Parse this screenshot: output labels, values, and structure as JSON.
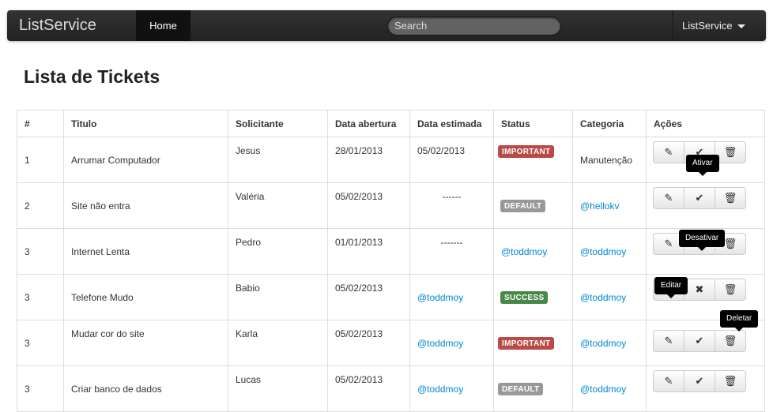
{
  "navbar": {
    "brand": "ListService",
    "home": "Home",
    "search_placeholder": "Search",
    "dropdown": "ListService"
  },
  "page": {
    "title": "Lista de Tickets"
  },
  "table": {
    "headers": [
      "#",
      "Titulo",
      "Solicitante",
      "Data abertura",
      "Data estimada",
      "Status",
      "Categoria",
      "Ações"
    ],
    "rows": [
      {
        "num": "1",
        "titulo": "Arrumar Computador",
        "solicitante": "Jesus",
        "abertura": "28/01/2013",
        "estimada": "05/02/2013",
        "status": "IMPORTANT",
        "categoria": "Manutenção"
      },
      {
        "num": "2",
        "titulo": "Site não entra",
        "solicitante": "Valéria",
        "abertura": "05/02/2013",
        "estimada": "------",
        "status": "DEFAULT",
        "categoria": "@hellokv"
      },
      {
        "num": "3",
        "titulo": "Internet Lenta",
        "solicitante": "Pedro",
        "abertura": "01/01/2013",
        "estimada": "-------",
        "status": "@toddmoy",
        "categoria": "@toddmoy"
      },
      {
        "num": "3",
        "titulo": "Telefone Mudo",
        "solicitante": "Babio",
        "abertura": "05/02/2013",
        "estimada": "@toddmoy",
        "status": "SUCCESS",
        "categoria": "@toddmoy"
      },
      {
        "num": "3",
        "titulo": "Mudar cor do site",
        "solicitante": "Karla",
        "abertura": "05/02/2013",
        "estimada": "@toddmoy",
        "status": "IMPORTANT",
        "categoria": "@toddmoy"
      },
      {
        "num": "3",
        "titulo": "Criar banco de dados",
        "solicitante": "Lucas",
        "abertura": "05/02/2013",
        "estimada": "@toddmoy",
        "status": "DEFAULT",
        "categoria": "@toddmoy"
      }
    ]
  },
  "tooltips": {
    "ativar": "Ativar",
    "desativar": "Desativar",
    "editar": "Editar",
    "deletar": "Deletar"
  },
  "icons": {
    "edit": "pencil-icon",
    "check": "check-icon",
    "remove": "x-icon",
    "delete": "trash-icon"
  },
  "colors": {
    "important": "#b94a48",
    "default": "#999999",
    "success": "#468847",
    "link": "#0088cc"
  }
}
